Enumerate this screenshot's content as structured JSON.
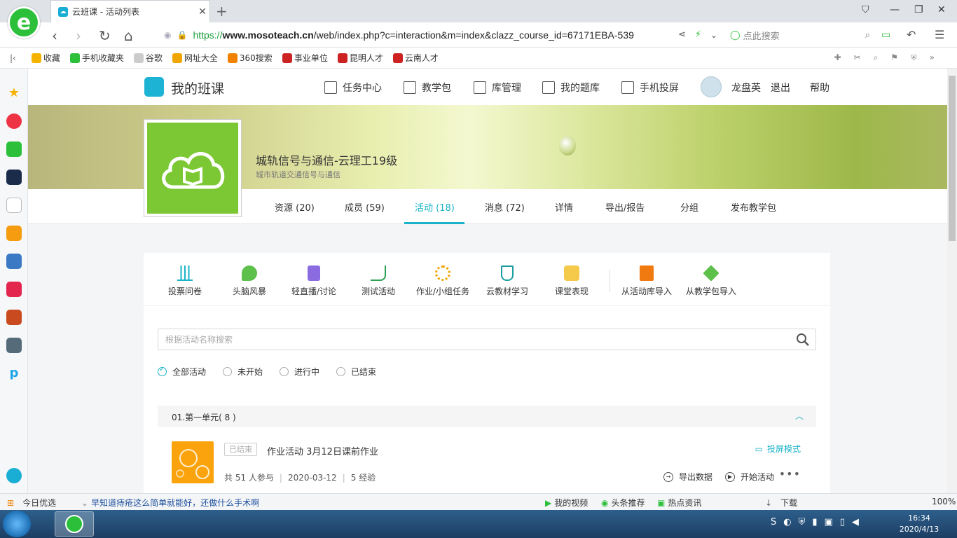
{
  "browser": {
    "tab_title": "云班课 - 活动列表",
    "url_https": "https://",
    "url_domain": "www.mosoteach.cn",
    "url_path": "/web/index.php?c=interaction&m=index&clazz_course_id=67171EBA-539",
    "search_placeholder": "点此搜索"
  },
  "bookmarks": [
    {
      "label": "收藏",
      "color": "#f5b301"
    },
    {
      "label": "手机收藏夹",
      "color": "#2bbf3a"
    },
    {
      "label": "谷歌",
      "color": "#cccccc"
    },
    {
      "label": "网址大全",
      "color": "#f0a500"
    },
    {
      "label": "360搜索",
      "color": "#f08200"
    },
    {
      "label": "事业单位",
      "color": "#c22"
    },
    {
      "label": "昆明人才",
      "color": "#c22"
    },
    {
      "label": "云南人才",
      "color": "#c22"
    }
  ],
  "site": {
    "name": "我的班课",
    "nav": [
      "任务中心",
      "教学包",
      "库管理",
      "我的题库",
      "手机投屏"
    ],
    "user": "龙盘英",
    "logout": "退出",
    "help": "帮助"
  },
  "course": {
    "title": "城轨信号与通信-云理工19级",
    "subtitle": "城市轨道交通信号与通信"
  },
  "course_tabs": [
    "资源 (20)",
    "成员 (59)",
    "活动 (18)",
    "消息 (72)",
    "详情",
    "导出/报告",
    "分组",
    "发布教学包"
  ],
  "tools": [
    {
      "label": "投票问卷",
      "color": "#1ab3c8"
    },
    {
      "label": "头脑风暴",
      "color": "#5cc04a"
    },
    {
      "label": "轻直播/讨论",
      "color": "#8a6be0"
    },
    {
      "label": "测试活动",
      "color": "#2aa050"
    },
    {
      "label": "作业/小组任务",
      "color": "#f0a500"
    },
    {
      "label": "云教材学习",
      "color": "#1a9ea0"
    },
    {
      "label": "课堂表现",
      "color": "#f5b301"
    },
    {
      "label": "从活动库导入",
      "color": "#f07a10"
    },
    {
      "label": "从教学包导入",
      "color": "#5cc04a"
    }
  ],
  "search": {
    "placeholder": "根据活动名称搜索"
  },
  "filters": [
    "全部活动",
    "未开始",
    "进行中",
    "已结束"
  ],
  "unit": {
    "title": "01.第一单元( 8 )"
  },
  "activity": {
    "status": "已结束",
    "title": "作业活动 3月12日课前作业",
    "participants": "共 51 人参与",
    "date": "2020-03-12",
    "exp": "5 经验",
    "project_mode": "投屏模式",
    "export": "导出数据",
    "start": "开始活动",
    "more": "•••"
  },
  "statusbar": {
    "today": "今日优选",
    "news": "早知道痔疮这么简单就能好，还做什么手术啊",
    "items": [
      "我的视频",
      "头条推荐",
      "热点资讯",
      "下载"
    ],
    "zoom": "100%"
  },
  "taskbar": {
    "time": "16:34",
    "date": "2020/4/13"
  }
}
